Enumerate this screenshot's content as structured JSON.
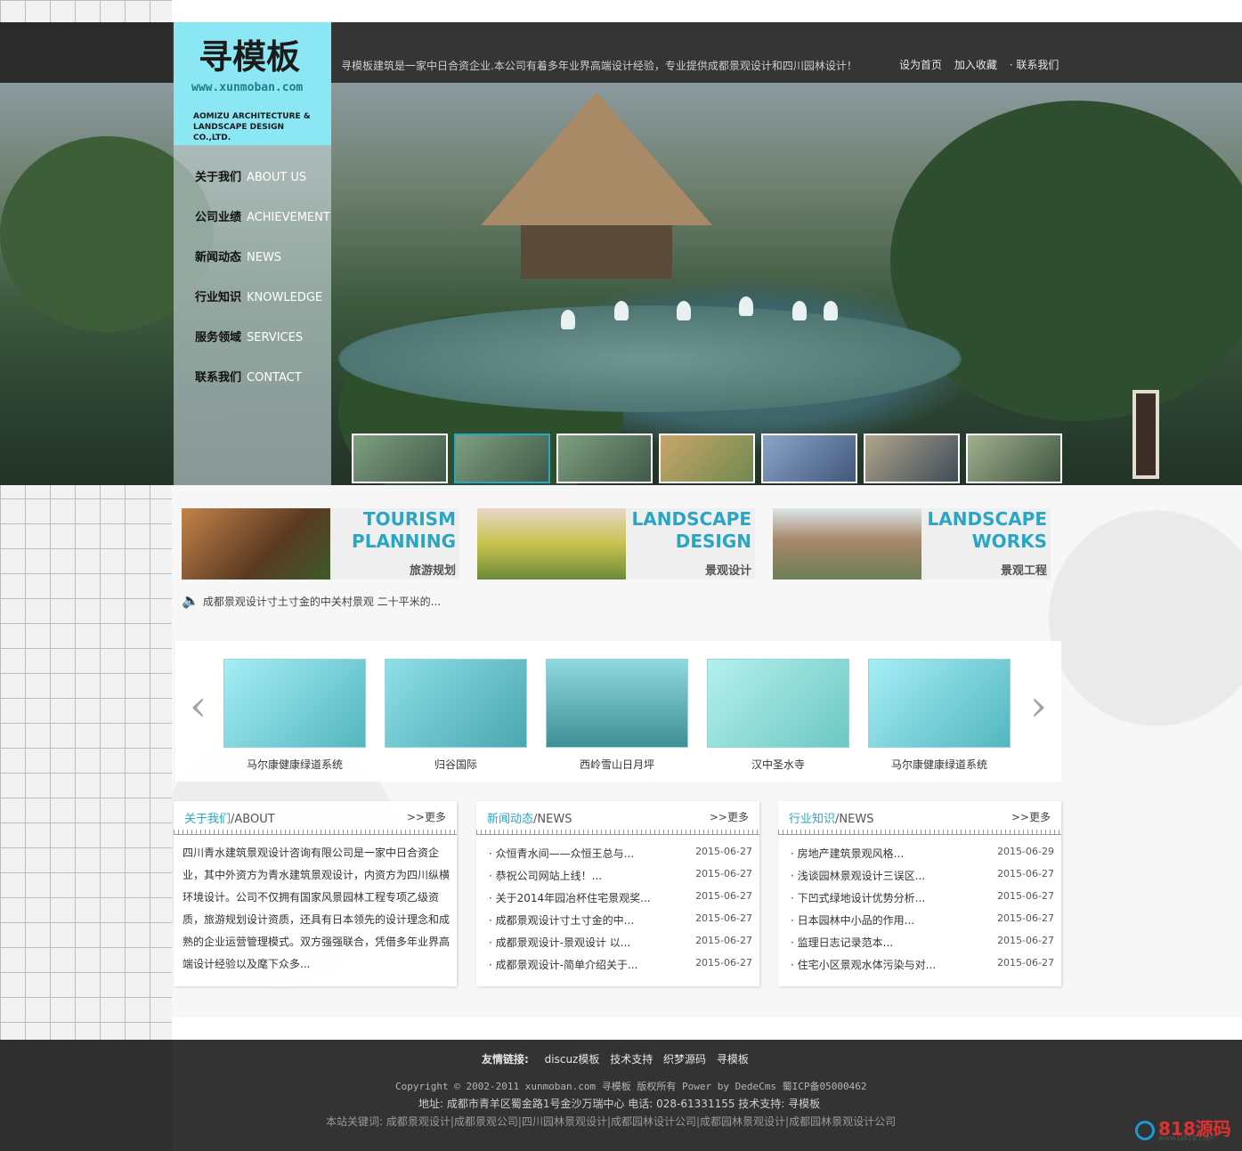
{
  "header": {
    "logo_cn": "寻模板",
    "logo_url": "www.xunmoban.com",
    "logo_en": "AOMIZU ARCHITECTURE & LANDSCAPE DESIGN CO.,LTD.",
    "intro": "寻模板建筑是一家中日合资企业.本公司有着多年业界高端设计经验，专业提供成都景观设计和四川园林设计！",
    "links": [
      "设为首页",
      "加入收藏",
      "· 联系我们"
    ]
  },
  "nav": [
    {
      "zh": "关于我们",
      "en": "ABOUT US"
    },
    {
      "zh": "公司业绩",
      "en": "ACHIEVEMENT"
    },
    {
      "zh": "新闻动态",
      "en": "NEWS"
    },
    {
      "zh": "行业知识",
      "en": "KNOWLEDGE"
    },
    {
      "zh": "服务领域",
      "en": "SERVICES"
    },
    {
      "zh": "联系我们",
      "en": "CONTACT"
    }
  ],
  "banners": [
    {
      "en": "TOURISM\nPLANNING",
      "zh": "旅游规划",
      "color": "#7a4a2a"
    },
    {
      "en": "LANDSCAPE\nDESIGN",
      "zh": "景观设计",
      "color": "#a9b24a"
    },
    {
      "en": "LANDSCAPE\nWORKS",
      "zh": "景观工程",
      "color": "#9a7a5a"
    }
  ],
  "notice": "成都景观设计寸土寸金的中关村景观 二十平米的...",
  "carousel": {
    "prev": "‹",
    "next": "›",
    "items": [
      "马尔康健康绿道系统",
      "归谷国际",
      "西岭雪山日月坪",
      "汉中圣水寺",
      "马尔康健康绿道系统"
    ]
  },
  "panels": {
    "about": {
      "title_zh": "关于我们",
      "title_en": "/ABOUT",
      "more": ">>更多",
      "text": "四川青水建筑景观设计咨询有限公司是一家中日合资企业，其中外资方为青水建筑景观设计，内资方为四川纵横环境设计。公司不仅拥有国家风景园林工程专项乙级资质，旅游规划设计资质，还具有日本领先的设计理念和成熟的企业运营管理模式。双方强强联合，凭借多年业界高端设计经验以及麾下众多..."
    },
    "news": {
      "title_zh": "新闻动态",
      "title_en": "/NEWS",
      "more": ">>更多",
      "items": [
        {
          "t": "众恒青水间——众恒王总与...",
          "d": "2015-06-27"
        },
        {
          "t": "恭祝公司网站上线！...",
          "d": "2015-06-27"
        },
        {
          "t": "关于2014年园冶杯住宅景观奖...",
          "d": "2015-06-27"
        },
        {
          "t": "成都景观设计寸土寸金的中...",
          "d": "2015-06-27"
        },
        {
          "t": "成都景观设计-景观设计 以...",
          "d": "2015-06-27"
        },
        {
          "t": "成都景观设计-简单介绍关于...",
          "d": "2015-06-27"
        }
      ]
    },
    "knowledge": {
      "title_zh": "行业知识",
      "title_en": "/NEWS",
      "more": ">>更多",
      "items": [
        {
          "t": "房地产建筑景观风格...",
          "d": "2015-06-29"
        },
        {
          "t": "浅谈园林景观设计三误区...",
          "d": "2015-06-27"
        },
        {
          "t": "下凹式绿地设计优势分析...",
          "d": "2015-06-27"
        },
        {
          "t": "日本园林中小品的作用...",
          "d": "2015-06-27"
        },
        {
          "t": "监理日志记录范本...",
          "d": "2015-06-27"
        },
        {
          "t": "住宅小区景观水体污染与对...",
          "d": "2015-06-27"
        }
      ]
    }
  },
  "footer": {
    "links_label": "友情链接:",
    "links": [
      "discuz模板",
      "技术支持",
      "织梦源码",
      "寻模板"
    ],
    "copyright": "Copyright © 2002-2011 xunmoban.com 寻模板 版权所有 Power by DedeCms 蜀ICP备05000462",
    "address": "地址: 成都市青羊区蜀金路1号金沙万瑞中心 电话: 028-61331155 技术支持: 寻模板",
    "keywords": "本站关键词: 成都景观设计|成都景观公司|四川园林景观设计|成都园林设计公司|成都园林景观设计|成都园林景观设计公司"
  },
  "watermark": {
    "main": "818源码",
    "sub": "www.Q818.com"
  },
  "colors": {
    "accent": "#2aa6c4",
    "logo_bg": "#8ce7f5",
    "topbar": "#353535"
  }
}
